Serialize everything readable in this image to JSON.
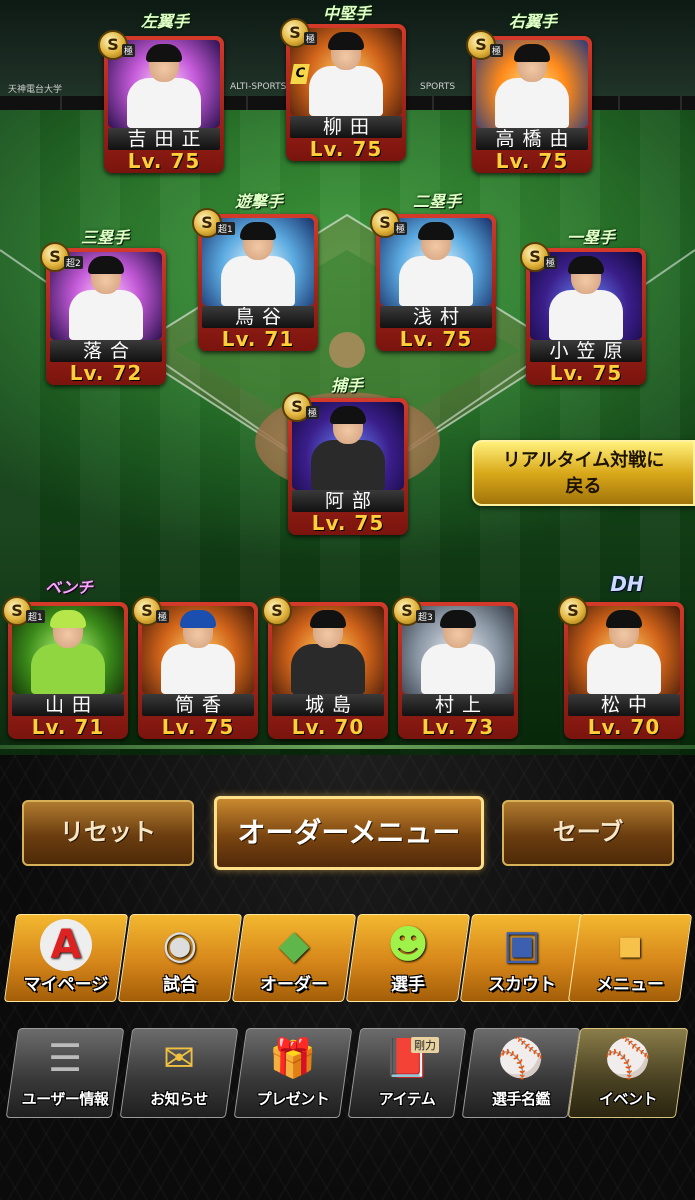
{
  "field": {
    "stand_sign_left": "天神電台大学",
    "stand_sign_center": "ALTI-SPORTS",
    "stand_sign_right": "SPORTS"
  },
  "positions": {
    "lf": "左翼手",
    "cf": "中堅手",
    "rf": "右翼手",
    "ss": "遊撃手",
    "b2": "二塁手",
    "b3": "三塁手",
    "b1": "一塁手",
    "c": "捕手",
    "bench": "ベンチ",
    "dh": "DH"
  },
  "players": {
    "lf": {
      "name": "吉田正",
      "level": "Lv. 75",
      "rank": "S",
      "rank_sub": "極"
    },
    "cf": {
      "name": "柳田",
      "level": "Lv. 75",
      "rank": "S",
      "rank_sub": "極",
      "captain": "C"
    },
    "rf": {
      "name": "高橋由",
      "level": "Lv. 75",
      "rank": "S",
      "rank_sub": "極"
    },
    "ss": {
      "name": "鳥谷",
      "level": "Lv. 71",
      "rank": "S",
      "rank_sub": "超1"
    },
    "b2": {
      "name": "浅村",
      "level": "Lv. 75",
      "rank": "S",
      "rank_sub": "極"
    },
    "b3": {
      "name": "落合",
      "level": "Lv. 72",
      "rank": "S",
      "rank_sub": "超2"
    },
    "b1": {
      "name": "小笠原",
      "level": "Lv. 75",
      "rank": "S",
      "rank_sub": "極"
    },
    "c": {
      "name": "阿部",
      "level": "Lv. 75",
      "rank": "S",
      "rank_sub": "極"
    },
    "bench": [
      {
        "name": "山田",
        "level": "Lv. 71",
        "rank": "S",
        "rank_sub": "超1"
      },
      {
        "name": "筒香",
        "level": "Lv. 75",
        "rank": "S",
        "rank_sub": "極"
      },
      {
        "name": "城島",
        "level": "Lv. 70",
        "rank": "S",
        "rank_sub": ""
      },
      {
        "name": "村上",
        "level": "Lv. 73",
        "rank": "S",
        "rank_sub": "超3"
      }
    ],
    "dh": {
      "name": "松中",
      "level": "Lv. 70",
      "rank": "S",
      "rank_sub": ""
    }
  },
  "realtime_button": {
    "line1": "リアルタイム対戦に",
    "line2": "戻る"
  },
  "order_buttons": {
    "reset": "リセット",
    "menu": "オーダーメニュー",
    "save": "セーブ"
  },
  "nav": [
    {
      "label": "マイページ",
      "icon": "my-page-icon",
      "glyph": "A"
    },
    {
      "label": "試合",
      "icon": "stadium-icon",
      "glyph": "◉"
    },
    {
      "label": "オーダー",
      "icon": "order-field-icon",
      "glyph": "◆"
    },
    {
      "label": "選手",
      "icon": "player-icon",
      "glyph": "☻"
    },
    {
      "label": "スカウト",
      "icon": "scout-card-icon",
      "glyph": "▣"
    },
    {
      "label": "メニュー",
      "icon": "menu-mascot-icon",
      "glyph": "▪"
    }
  ],
  "sub_nav": [
    {
      "label": "ユーザー情報",
      "icon": "user-info-icon",
      "glyph": "☰"
    },
    {
      "label": "お知らせ",
      "icon": "notice-icon",
      "glyph": "✉"
    },
    {
      "label": "プレゼント",
      "icon": "present-icon",
      "glyph": "🎁"
    },
    {
      "label": "アイテム",
      "icon": "item-book-icon",
      "glyph": "📕",
      "badge": "剛力"
    },
    {
      "label": "選手名鑑",
      "icon": "player-directory-icon",
      "glyph": "⚾"
    },
    {
      "label": "イベント",
      "icon": "event-icon",
      "glyph": "⚾"
    }
  ]
}
